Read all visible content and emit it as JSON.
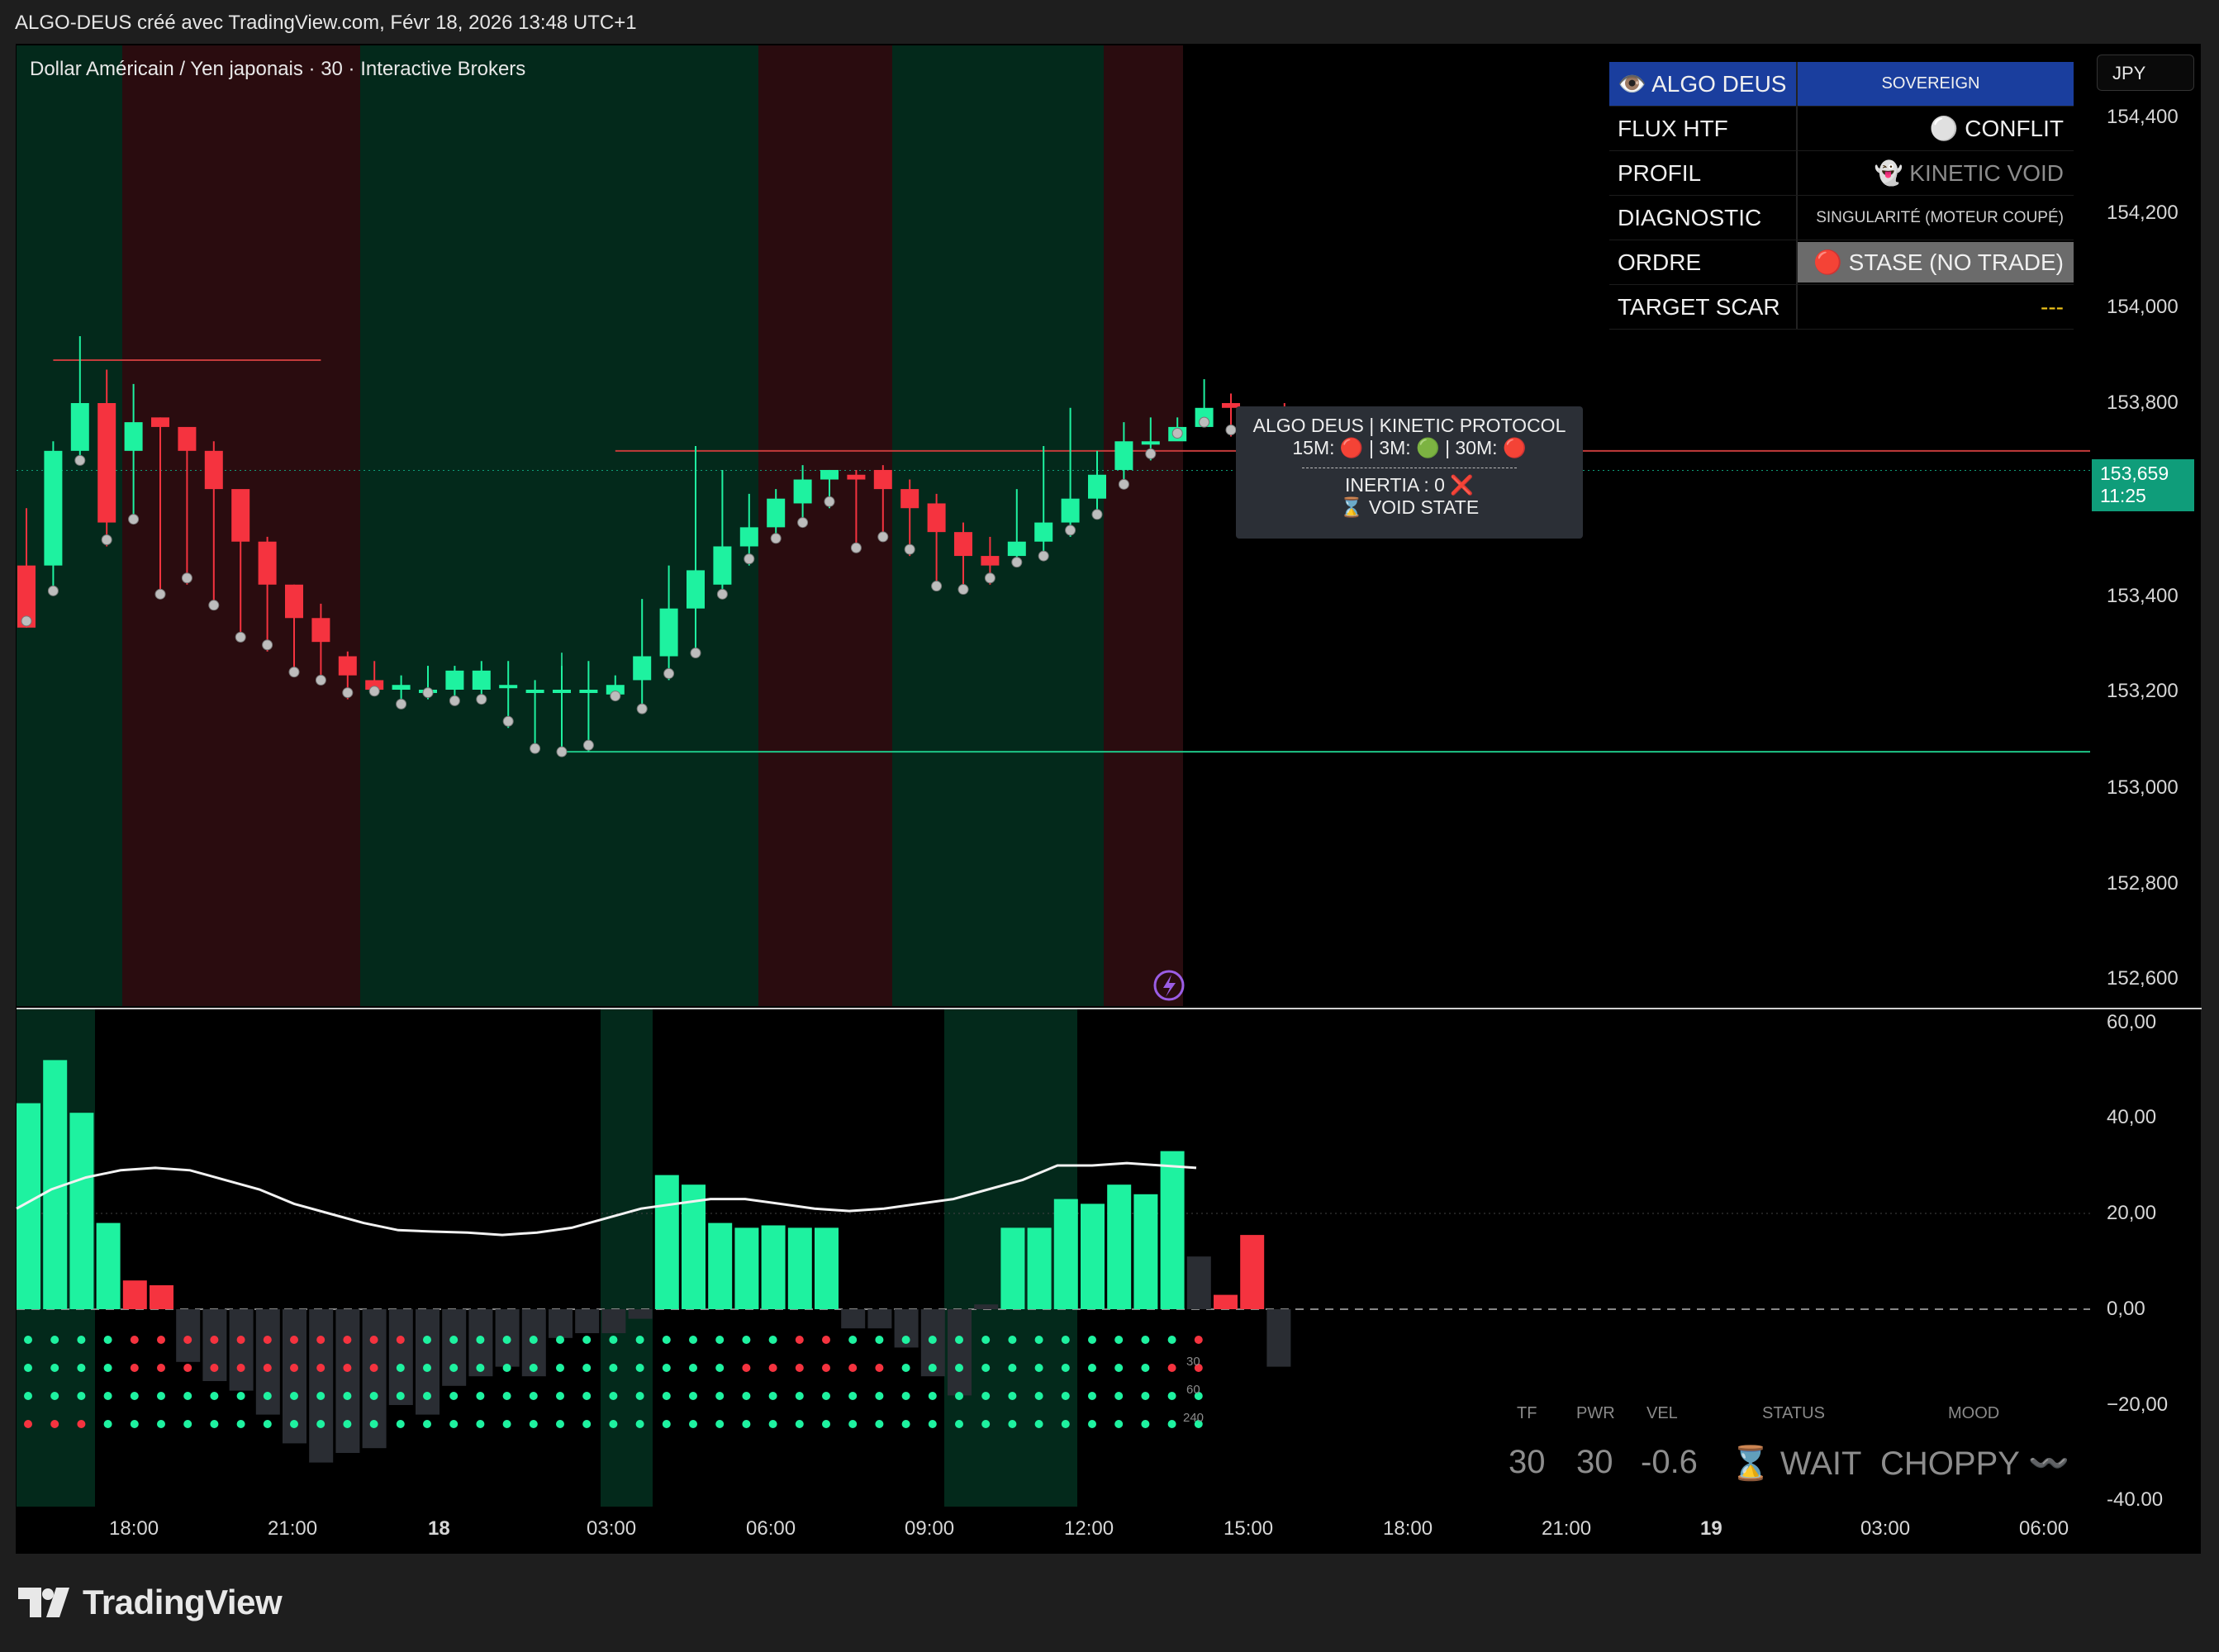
{
  "page_title": "ALGO-DEUS créé avec TradingView.com, Févr 18, 2026 13:48 UTC+1",
  "symbol": "Dollar Américain / Yen japonais · 30 · Interactive Brokers",
  "currency": "JPY",
  "brand": "TradingView",
  "last_price": {
    "price": "153,659",
    "countdown": "11:25"
  },
  "panel": {
    "header_left": "👁️ ALGO DEUS",
    "header_right": "SOVEREIGN",
    "rows": [
      {
        "label": "FLUX HTF",
        "value": "⚪ CONFLIT"
      },
      {
        "label": "PROFIL",
        "value": "👻 KINETIC VOID"
      },
      {
        "label": "DIAGNOSTIC",
        "value": "SINGULARITÉ (MOTEUR COUPÉ)"
      },
      {
        "label": "ORDRE",
        "value": "🔴 STASE (NO TRADE)"
      },
      {
        "label": "TARGET SCAR",
        "value": "---"
      }
    ],
    "colors": {
      "header": "#1a3e9e",
      "ordre_bg": "#6b6b6b",
      "target": "#f0c419"
    }
  },
  "tooltip": {
    "line1": "ALGO DEUS | KINETIC PROTOCOL",
    "line2": "15M: 🔴 | 3M: 🟢 | 30M: 🔴",
    "line3": "INERTIA : 0 ❌",
    "line4": "⌛ VOID STATE"
  },
  "status_table": {
    "headers": [
      "TF",
      "PWR",
      "VEL",
      "STATUS",
      "MOOD"
    ],
    "values": [
      "30",
      "30",
      "-0.6",
      "⌛ WAIT",
      "CHOPPY 〰️"
    ]
  },
  "dot_row_labels": [
    "30",
    "60",
    "240"
  ],
  "icon": "lightning-icon",
  "colors": {
    "bull": "#1ef2a0",
    "bear": "#f5333f",
    "bg_green": "#03291b",
    "bg_red": "#2a0c0f"
  },
  "chart_data": [
    {
      "type": "candlestick",
      "title": "Dollar Américain / Yen japonais · 30 · Interactive Brokers",
      "y_axis": {
        "min": 152550,
        "max": 154550,
        "ticks": [
          "154,400",
          "154,200",
          "154,000",
          "153,800",
          "153,400",
          "153,200",
          "153,000",
          "152,800",
          "152,600"
        ]
      },
      "x_ticks": [
        "18:00",
        "21:00",
        "18",
        "03:00",
        "06:00",
        "09:00",
        "12:00",
        "15:00",
        "18:00",
        "21:00",
        "19",
        "03:00",
        "06:00"
      ],
      "candles": [
        [
          153.46,
          153.58,
          153.33,
          153.33
        ],
        [
          153.46,
          153.72,
          153.4,
          153.7
        ],
        [
          153.7,
          153.94,
          153.68,
          153.8
        ],
        [
          153.8,
          153.87,
          153.5,
          153.55
        ],
        [
          153.7,
          153.84,
          153.55,
          153.76
        ],
        [
          153.77,
          153.77,
          153.4,
          153.75
        ],
        [
          153.75,
          153.74,
          153.42,
          153.7
        ],
        [
          153.7,
          153.72,
          153.37,
          153.62
        ],
        [
          153.62,
          153.6,
          153.31,
          153.51
        ],
        [
          153.51,
          153.52,
          153.28,
          153.42
        ],
        [
          153.42,
          153.42,
          153.23,
          153.35
        ],
        [
          153.35,
          153.38,
          153.22,
          153.3
        ],
        [
          153.27,
          153.28,
          153.18,
          153.23
        ],
        [
          153.22,
          153.26,
          153.19,
          153.2
        ],
        [
          153.2,
          153.23,
          153.17,
          153.21
        ],
        [
          153.2,
          153.25,
          153.18,
          153.2
        ],
        [
          153.2,
          153.25,
          153.17,
          153.24
        ],
        [
          153.2,
          153.26,
          153.18,
          153.24
        ],
        [
          153.21,
          153.26,
          153.12,
          153.21
        ],
        [
          153.2,
          153.22,
          153.07,
          153.2
        ],
        [
          153.2,
          153.25,
          153.07,
          153.2
        ],
        [
          153.2,
          153.26,
          153.07,
          153.2
        ],
        [
          153.19,
          153.23,
          153.18,
          153.21
        ],
        [
          153.22,
          153.39,
          153.16,
          153.27
        ],
        [
          153.27,
          153.46,
          153.22,
          153.37
        ],
        [
          153.37,
          153.71,
          153.27,
          153.45
        ],
        [
          153.42,
          153.66,
          153.4,
          153.5
        ],
        [
          153.5,
          153.61,
          153.46,
          153.54
        ],
        [
          153.54,
          153.62,
          153.51,
          153.6
        ],
        [
          153.59,
          153.67,
          153.55,
          153.64
        ],
        [
          153.64,
          153.66,
          153.58,
          153.66
        ],
        [
          153.65,
          153.66,
          153.49,
          153.64
        ],
        [
          153.66,
          153.67,
          153.52,
          153.62
        ],
        [
          153.62,
          153.64,
          153.48,
          153.58
        ],
        [
          153.59,
          153.61,
          153.41,
          153.53
        ],
        [
          153.53,
          153.55,
          153.41,
          153.48
        ],
        [
          153.48,
          153.52,
          153.42,
          153.46
        ],
        [
          153.48,
          153.62,
          153.46,
          153.51
        ],
        [
          153.51,
          153.71,
          153.48,
          153.55
        ],
        [
          153.55,
          153.79,
          153.52,
          153.6
        ],
        [
          153.6,
          153.7,
          153.56,
          153.65
        ],
        [
          153.66,
          153.76,
          153.63,
          153.72
        ],
        [
          153.72,
          153.77,
          153.68,
          153.72
        ],
        [
          153.72,
          153.77,
          153.73,
          153.75
        ],
        [
          153.75,
          153.85,
          153.76,
          153.79
        ],
        [
          153.8,
          153.82,
          153.73,
          153.79
        ],
        [
          153.78,
          153.78,
          153.66,
          153.79
        ],
        [
          153.78,
          153.8,
          153.68,
          153.74
        ],
        [
          153.75,
          153.79,
          153.67,
          153.71
        ],
        [
          153.71,
          153.72,
          153.56,
          153.65
        ]
      ],
      "lines": [
        {
          "name": "red-level",
          "value": 153.89,
          "from_index": 1,
          "to_index": 11
        },
        {
          "name": "red-level-2",
          "value": 153.7,
          "from_index": 22,
          "to_index": 80
        },
        {
          "name": "green-level",
          "value": 153.07,
          "from_index": 20,
          "to_index": 80
        }
      ],
      "background_zones": [
        "green",
        "red",
        "green",
        "red",
        "green",
        "red"
      ]
    },
    {
      "type": "bar",
      "title": "",
      "y_axis": {
        "min": -43,
        "max": 62,
        "ticks": [
          "60,00",
          "40,00",
          "20,00",
          "0,00",
          "−20,00",
          "-40.00"
        ]
      },
      "values": [
        43,
        52,
        41,
        18,
        6,
        5,
        -11,
        -15,
        -17,
        -22,
        -28,
        -32,
        -30,
        -29,
        -20,
        -22,
        -16,
        -14,
        -12,
        -14,
        -6,
        -5,
        -5,
        -2,
        28,
        26,
        18,
        17,
        17.5,
        17,
        17,
        -4,
        -4,
        -8,
        -14,
        -18,
        1,
        17,
        17,
        23,
        22,
        26,
        24,
        33,
        11,
        3,
        15.5,
        -12
      ],
      "colors": [
        "green",
        "green",
        "green",
        "green",
        "red",
        "red",
        "gray",
        "gray",
        "gray",
        "gray",
        "gray",
        "gray",
        "gray",
        "gray",
        "gray",
        "gray",
        "gray",
        "gray",
        "gray",
        "gray",
        "gray",
        "gray",
        "gray",
        "gray",
        "green",
        "green",
        "green",
        "green",
        "green",
        "green",
        "green",
        "gray",
        "gray",
        "gray",
        "gray",
        "gray",
        "gray",
        "green",
        "green",
        "green",
        "green",
        "green",
        "green",
        "green",
        "gray",
        "red",
        "red",
        "gray"
      ],
      "signal_line": [
        21,
        25,
        27.5,
        29,
        29.5,
        29,
        27,
        25,
        22,
        20,
        18,
        16.5,
        16.2,
        16,
        15.5,
        16,
        17,
        19,
        21,
        22,
        23,
        23,
        22,
        21,
        20.5,
        21,
        22,
        23,
        25,
        27,
        30,
        30,
        30.5,
        30,
        29.5
      ]
    }
  ]
}
